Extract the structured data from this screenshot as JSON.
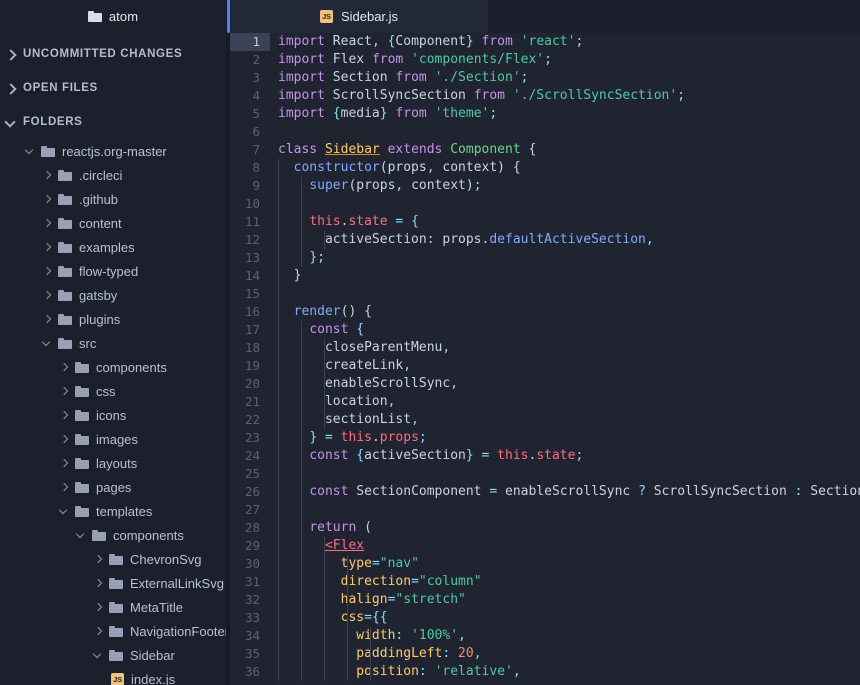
{
  "sidebar": {
    "header": {
      "title": "atom",
      "icon": "folder-icon"
    },
    "sections": [
      {
        "label": "UNCOMMITTED CHANGES",
        "expanded": false
      },
      {
        "label": "OPEN FILES",
        "expanded": false
      },
      {
        "label": "FOLDERS",
        "expanded": true
      }
    ],
    "tree": [
      {
        "label": "reactjs.org-master",
        "depth": 1,
        "type": "folder",
        "expanded": true
      },
      {
        "label": ".circleci",
        "depth": 2,
        "type": "folder",
        "expanded": false
      },
      {
        "label": ".github",
        "depth": 2,
        "type": "folder",
        "expanded": false
      },
      {
        "label": "content",
        "depth": 2,
        "type": "folder",
        "expanded": false
      },
      {
        "label": "examples",
        "depth": 2,
        "type": "folder",
        "expanded": false
      },
      {
        "label": "flow-typed",
        "depth": 2,
        "type": "folder",
        "expanded": false
      },
      {
        "label": "gatsby",
        "depth": 2,
        "type": "folder",
        "expanded": false
      },
      {
        "label": "plugins",
        "depth": 2,
        "type": "folder",
        "expanded": false
      },
      {
        "label": "src",
        "depth": 2,
        "type": "folder",
        "expanded": true
      },
      {
        "label": "components",
        "depth": 3,
        "type": "folder",
        "expanded": false
      },
      {
        "label": "css",
        "depth": 3,
        "type": "folder",
        "expanded": false
      },
      {
        "label": "icons",
        "depth": 3,
        "type": "folder",
        "expanded": false
      },
      {
        "label": "images",
        "depth": 3,
        "type": "folder",
        "expanded": false
      },
      {
        "label": "layouts",
        "depth": 3,
        "type": "folder",
        "expanded": false
      },
      {
        "label": "pages",
        "depth": 3,
        "type": "folder",
        "expanded": false
      },
      {
        "label": "templates",
        "depth": 3,
        "type": "folder",
        "expanded": true
      },
      {
        "label": "components",
        "depth": 4,
        "type": "folder",
        "expanded": true
      },
      {
        "label": "ChevronSvg",
        "depth": 5,
        "type": "folder",
        "expanded": false
      },
      {
        "label": "ExternalLinkSvg",
        "depth": 5,
        "type": "folder",
        "expanded": false
      },
      {
        "label": "MetaTitle",
        "depth": 5,
        "type": "folder",
        "expanded": false
      },
      {
        "label": "NavigationFooter",
        "depth": 5,
        "type": "folder",
        "expanded": false
      },
      {
        "label": "Sidebar",
        "depth": 5,
        "type": "folder",
        "expanded": true
      },
      {
        "label": "index.js",
        "depth": 6,
        "type": "js-file"
      }
    ]
  },
  "editor": {
    "tab": {
      "label": "Sidebar.js",
      "icon": "js-file-icon",
      "badge": "JS"
    },
    "active_line": 1,
    "lines": [
      {
        "n": 1,
        "guides": 0,
        "text": "import React, {Component} from 'react';"
      },
      {
        "n": 2,
        "guides": 0,
        "text": "import Flex from 'components/Flex';"
      },
      {
        "n": 3,
        "guides": 0,
        "text": "import Section from './Section';"
      },
      {
        "n": 4,
        "guides": 0,
        "text": "import ScrollSyncSection from './ScrollSyncSection';"
      },
      {
        "n": 5,
        "guides": 0,
        "text": "import {media} from 'theme';"
      },
      {
        "n": 6,
        "guides": 0,
        "text": ""
      },
      {
        "n": 7,
        "guides": 0,
        "text": "class Sidebar extends Component {"
      },
      {
        "n": 8,
        "guides": 1,
        "text": "  constructor(props, context) {"
      },
      {
        "n": 9,
        "guides": 2,
        "text": "    super(props, context);"
      },
      {
        "n": 10,
        "guides": 2,
        "text": ""
      },
      {
        "n": 11,
        "guides": 2,
        "text": "    this.state = {"
      },
      {
        "n": 12,
        "guides": 3,
        "text": "      activeSection: props.defaultActiveSection,"
      },
      {
        "n": 13,
        "guides": 2,
        "text": "    };"
      },
      {
        "n": 14,
        "guides": 1,
        "text": "  }"
      },
      {
        "n": 15,
        "guides": 1,
        "text": ""
      },
      {
        "n": 16,
        "guides": 1,
        "text": "  render() {"
      },
      {
        "n": 17,
        "guides": 2,
        "text": "    const {"
      },
      {
        "n": 18,
        "guides": 3,
        "text": "      closeParentMenu,"
      },
      {
        "n": 19,
        "guides": 3,
        "text": "      createLink,"
      },
      {
        "n": 20,
        "guides": 3,
        "text": "      enableScrollSync,"
      },
      {
        "n": 21,
        "guides": 3,
        "text": "      location,"
      },
      {
        "n": 22,
        "guides": 3,
        "text": "      sectionList,"
      },
      {
        "n": 23,
        "guides": 2,
        "text": "    } = this.props;"
      },
      {
        "n": 24,
        "guides": 2,
        "text": "    const {activeSection} = this.state;"
      },
      {
        "n": 25,
        "guides": 2,
        "text": ""
      },
      {
        "n": 26,
        "guides": 2,
        "text": "    const SectionComponent = enableScrollSync ? ScrollSyncSection : Section;"
      },
      {
        "n": 27,
        "guides": 2,
        "text": ""
      },
      {
        "n": 28,
        "guides": 2,
        "text": "    return ("
      },
      {
        "n": 29,
        "guides": 3,
        "text": "      <Flex"
      },
      {
        "n": 30,
        "guides": 4,
        "text": "        type=\"nav\""
      },
      {
        "n": 31,
        "guides": 4,
        "text": "        direction=\"column\""
      },
      {
        "n": 32,
        "guides": 4,
        "text": "        halign=\"stretch\""
      },
      {
        "n": 33,
        "guides": 4,
        "text": "        css={{"
      },
      {
        "n": 34,
        "guides": 5,
        "text": "          width: '100%',"
      },
      {
        "n": 35,
        "guides": 5,
        "text": "          paddingLeft: 20,"
      },
      {
        "n": 36,
        "guides": 5,
        "text": "          position: 'relative',"
      }
    ]
  },
  "colors": {
    "sidebar_bg": "#1c202c",
    "editor_bg": "#1f2430",
    "tab_active_bg": "#232838",
    "accent": "#5b7cfa",
    "keyword": "#c792ea",
    "string": "#4ec9a8",
    "function": "#82aaff",
    "class": "#6bd68a",
    "this": "#ff6b81",
    "attribute": "#ffcb6b",
    "number": "#f78c6c",
    "punctuation": "#89ddff",
    "js_icon": "#f0c27b"
  }
}
